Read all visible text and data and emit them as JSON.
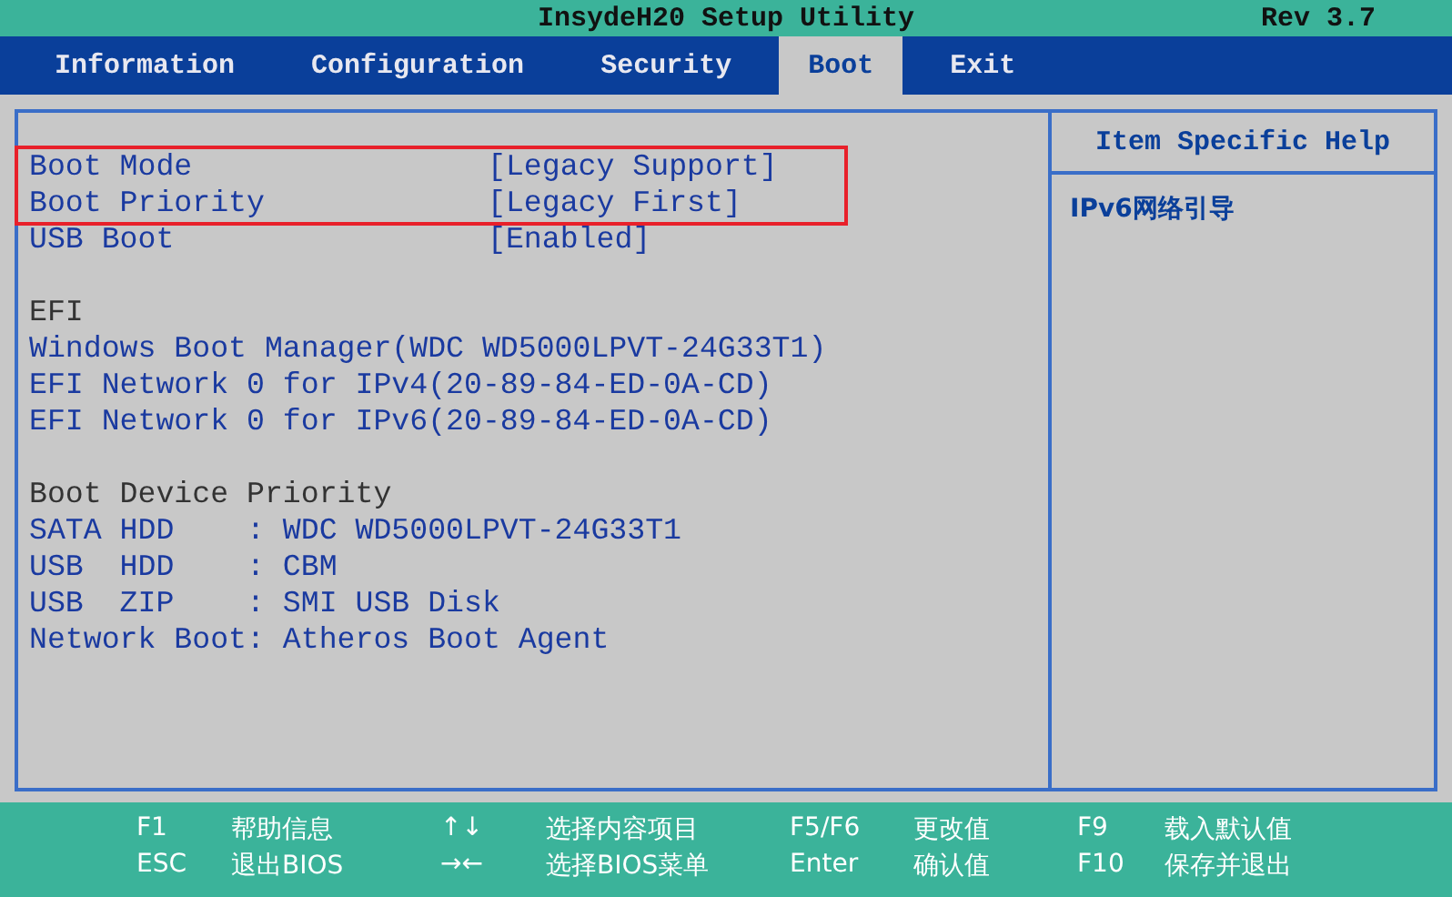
{
  "title_bar": {
    "title": "InsydeH20 Setup Utility",
    "revision": "Rev 3.7"
  },
  "tabs": [
    {
      "label": "Information",
      "selected": false
    },
    {
      "label": "Configuration",
      "selected": false
    },
    {
      "label": "Security",
      "selected": false
    },
    {
      "label": "Boot",
      "selected": true
    },
    {
      "label": "Exit",
      "selected": false
    }
  ],
  "settings": [
    {
      "label": "Boot Mode",
      "value": "[Legacy Support]",
      "highlighted": true
    },
    {
      "label": "Boot Priority",
      "value": "[Legacy First]",
      "highlighted": true
    },
    {
      "label": "USB Boot",
      "value": "[Enabled]",
      "highlighted": false
    }
  ],
  "sections": [
    {
      "heading": "EFI",
      "items": [
        "Windows Boot Manager(WDC WD5000LPVT-24G33T1)",
        "EFI Network 0 for IPv4(20-89-84-ED-0A-CD)",
        "EFI Network 0 for IPv6(20-89-84-ED-0A-CD)"
      ]
    },
    {
      "heading": "Boot Device Priority",
      "items": [
        "SATA HDD    : WDC WD5000LPVT-24G33T1",
        "USB  HDD    : CBM",
        "USB  ZIP    : SMI USB Disk",
        "Network Boot: Atheros Boot Agent"
      ]
    }
  ],
  "help": {
    "title": "Item Specific Help",
    "text": "IPv6网络引导"
  },
  "footer": [
    [
      {
        "key": "F1",
        "action": "帮助信息"
      },
      {
        "key": "ESC",
        "action": "退出BIOS"
      }
    ],
    [
      {
        "key": "↑↓",
        "action": "选择内容项目"
      },
      {
        "key": "→←",
        "action": "选择BIOS菜单"
      }
    ],
    [
      {
        "key": "F5/F6",
        "action": "更改值"
      },
      {
        "key": "Enter",
        "action": "确认值"
      }
    ],
    [
      {
        "key": "F9",
        "action": "载入默认值"
      },
      {
        "key": "F10",
        "action": "保存并退出"
      }
    ]
  ]
}
